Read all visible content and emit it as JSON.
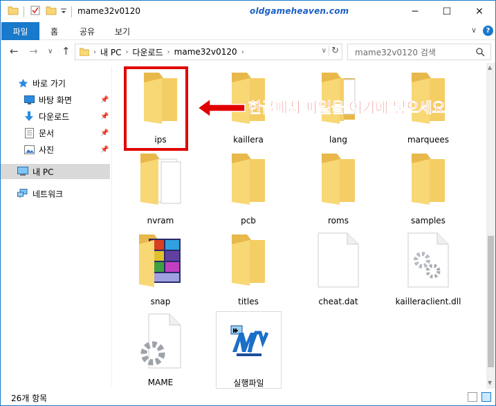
{
  "window": {
    "title": "mame32v0120",
    "watermark": "oldgameheaven.com",
    "minimize": "─",
    "maximize": "☐",
    "close": "✕"
  },
  "ribbon": {
    "file_tab": "파일",
    "tabs": [
      "홈",
      "공유",
      "보기"
    ],
    "expand": "∨",
    "help": "?"
  },
  "nav": {
    "back": "←",
    "forward": "→",
    "recent": "∨",
    "up": "↑"
  },
  "address": {
    "crumbs": [
      "내 PC",
      "다운로드",
      "mame32v0120"
    ],
    "separator": "›",
    "dropdown": "∨",
    "refresh": "↻"
  },
  "search": {
    "placeholder": "mame32v0120 검색",
    "icon": "search-icon"
  },
  "sidebar": {
    "items": [
      {
        "label": "바로 가기",
        "icon": "star-icon"
      },
      {
        "label": "바탕 화면",
        "icon": "desktop-icon",
        "pinned": true
      },
      {
        "label": "다운로드",
        "icon": "download-icon",
        "pinned": true
      },
      {
        "label": "문서",
        "icon": "document-icon",
        "pinned": true
      },
      {
        "label": "사진",
        "icon": "pictures-icon",
        "pinned": true
      },
      {
        "label": "내 PC",
        "icon": "computer-icon",
        "selected": true
      },
      {
        "label": "네트워크",
        "icon": "network-icon"
      }
    ]
  },
  "files": [
    {
      "name": "ips",
      "type": "folder"
    },
    {
      "name": "kaillera",
      "type": "folder"
    },
    {
      "name": "lang",
      "type": "folder-docs"
    },
    {
      "name": "marquees",
      "type": "folder"
    },
    {
      "name": "nvram",
      "type": "folder-docs"
    },
    {
      "name": "pcb",
      "type": "folder"
    },
    {
      "name": "roms",
      "type": "folder"
    },
    {
      "name": "samples",
      "type": "folder"
    },
    {
      "name": "snap",
      "type": "folder-images"
    },
    {
      "name": "titles",
      "type": "folder"
    },
    {
      "name": "cheat.dat",
      "type": "file"
    },
    {
      "name": "kailleraclient.dll",
      "type": "dll"
    },
    {
      "name": "MAME",
      "type": "config"
    },
    {
      "name": "실행파일",
      "type": "exe"
    }
  ],
  "annotation": {
    "text": "한글패치 파일을 여기에 넣으세요",
    "color": "#e00000"
  },
  "status": {
    "count": "26개 항목"
  },
  "colors": {
    "accent": "#1979ca",
    "folder": "#f8d775",
    "folder_dark": "#e8b84a"
  }
}
